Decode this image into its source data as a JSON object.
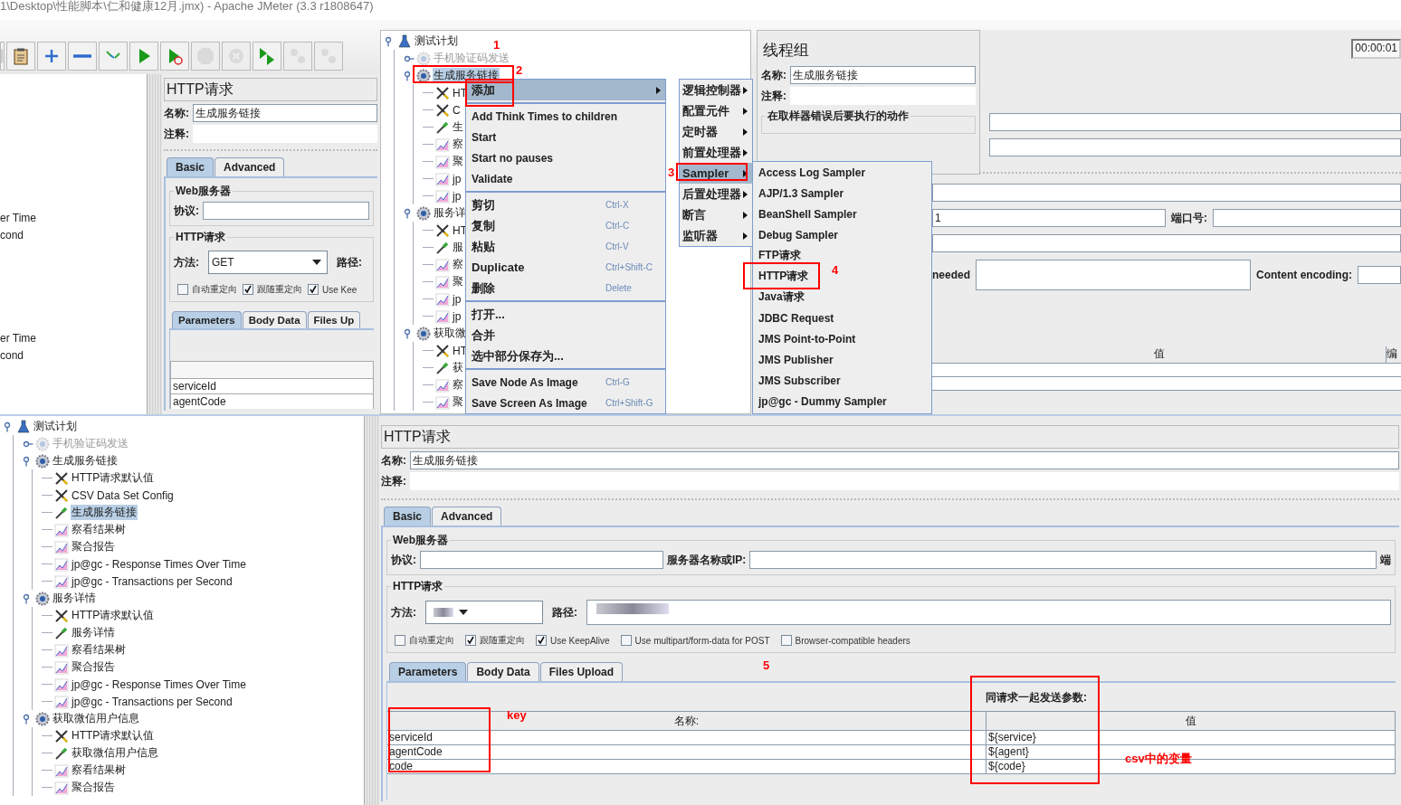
{
  "top": {
    "window": {
      "title": "1\\Desktop\\性能脚本\\仁和健康12月.jmx) - Apache JMeter (3.3 r1808647)"
    },
    "toolbar": [
      {
        "kind": "edge",
        "disabled": false
      },
      {
        "kind": "paste",
        "disabled": false
      },
      {
        "kind": "expand",
        "disabled": false
      },
      {
        "kind": "collapse",
        "disabled": false
      },
      {
        "kind": "toggle",
        "disabled": false
      },
      {
        "kind": "start",
        "disabled": false
      },
      {
        "kind": "start_no_pause",
        "disabled": false
      },
      {
        "kind": "stop",
        "disabled": true
      },
      {
        "kind": "shutdown",
        "disabled": true
      },
      {
        "kind": "remote_start",
        "disabled": false
      },
      {
        "kind": "remote_stop",
        "disabled": true
      },
      {
        "kind": "remote_shutdown",
        "disabled": true
      }
    ],
    "tree_fragments": [
      "er Time",
      "cond",
      "er Time",
      "cond"
    ],
    "http_panel": {
      "title": "HTTP请求",
      "name_label": "名称:",
      "name_value": "生成服务链接",
      "comment_label": "注释:",
      "tabs": [
        {
          "label": "Basic",
          "selected": true
        },
        {
          "label": "Advanced",
          "selected": false
        }
      ],
      "web_group": "Web服务器",
      "protocol_label": "协议:",
      "http_group": "HTTP请求",
      "method_label": "方法:",
      "method_value": "GET",
      "path_label": "路径:",
      "checkboxes": [
        {
          "label": "自动重定向",
          "checked": false
        },
        {
          "label": "跟随重定向",
          "checked": true
        },
        {
          "label": "Use Kee",
          "checked": true
        }
      ],
      "param_tabs": [
        {
          "label": "Parameters",
          "selected": true
        },
        {
          "label": "Body Data",
          "selected": false
        },
        {
          "label": "Files Up",
          "selected": false
        }
      ],
      "rows": [
        "serviceId",
        "agentCode"
      ]
    },
    "tree": [
      {
        "kind": "plan",
        "label": "测试计划",
        "selected": false,
        "disabled": false,
        "expanded": true,
        "children": [
          {
            "kind": "thread_group",
            "label": "手机验证码发送",
            "selected": false,
            "disabled": true,
            "expanded": false
          },
          {
            "kind": "thread_group",
            "label": "生成服务链接",
            "selected": true,
            "disabled": false,
            "expanded": true,
            "children": [
              {
                "kind": "config",
                "label": "HT",
                "selected": false,
                "disabled": false
              },
              {
                "kind": "config",
                "label": "C",
                "selected": false,
                "disabled": false
              },
              {
                "kind": "sampler",
                "label": "生",
                "selected": false,
                "disabled": false
              },
              {
                "kind": "listener",
                "label": "察",
                "selected": false,
                "disabled": false
              },
              {
                "kind": "listener",
                "label": "聚",
                "selected": false,
                "disabled": false
              },
              {
                "kind": "listener",
                "label": "jp",
                "selected": false,
                "disabled": false
              },
              {
                "kind": "listener",
                "label": "jp",
                "selected": false,
                "disabled": false
              }
            ]
          },
          {
            "kind": "thread_group",
            "label": "服务详",
            "selected": false,
            "disabled": false,
            "expanded": true,
            "children": [
              {
                "kind": "config",
                "label": "HT",
                "selected": false,
                "disabled": false
              },
              {
                "kind": "sampler",
                "label": "服",
                "selected": false,
                "disabled": false
              },
              {
                "kind": "listener",
                "label": "察",
                "selected": false,
                "disabled": false
              },
              {
                "kind": "listener",
                "label": "聚",
                "selected": false,
                "disabled": false
              },
              {
                "kind": "listener",
                "label": "jp",
                "selected": false,
                "disabled": false
              },
              {
                "kind": "listener",
                "label": "jp",
                "selected": false,
                "disabled": false
              }
            ]
          },
          {
            "kind": "thread_group",
            "label": "获取微",
            "selected": false,
            "disabled": false,
            "expanded": true,
            "children": [
              {
                "kind": "config",
                "label": "HT",
                "selected": false,
                "disabled": false
              },
              {
                "kind": "sampler",
                "label": "获",
                "selected": false,
                "disabled": false
              },
              {
                "kind": "listener",
                "label": "察",
                "selected": false,
                "disabled": false
              },
              {
                "kind": "listener",
                "label": "聚",
                "selected": false,
                "disabled": false
              }
            ]
          }
        ]
      }
    ],
    "context_menu": [
      [
        {
          "kind": "submenu",
          "label": "添加",
          "selected": true
        }
      ],
      [
        {
          "kind": "item",
          "label": "Add Think Times to children",
          "selected": false
        },
        {
          "kind": "item",
          "label": "Start",
          "selected": false
        },
        {
          "kind": "item",
          "label": "Start no pauses",
          "selected": false
        },
        {
          "kind": "item",
          "label": "Validate",
          "selected": false
        }
      ],
      [
        {
          "kind": "item",
          "label": "剪切",
          "shortcut": "Ctrl-X",
          "selected": false
        },
        {
          "kind": "item",
          "label": "复制",
          "shortcut": "Ctrl-C",
          "selected": false
        },
        {
          "kind": "item",
          "label": "粘贴",
          "shortcut": "Ctrl-V",
          "selected": false
        },
        {
          "kind": "item",
          "label": "Duplicate",
          "shortcut": "Ctrl+Shift-C",
          "selected": false
        },
        {
          "kind": "item",
          "label": "删除",
          "shortcut": "Delete",
          "selected": false
        }
      ],
      [
        {
          "kind": "item",
          "label": "打开...",
          "selected": false
        },
        {
          "kind": "item",
          "label": "合并",
          "selected": false
        },
        {
          "kind": "item",
          "label": "选中部分保存为...",
          "selected": false
        }
      ],
      [
        {
          "kind": "item",
          "label": "Save Node As Image",
          "shortcut": "Ctrl-G",
          "selected": false
        },
        {
          "kind": "item",
          "label": "Save Screen As Image",
          "shortcut": "Ctrl+Shift-G",
          "selected": false
        }
      ]
    ],
    "add_submenu": [
      {
        "label": "逻辑控制器",
        "selected": false
      },
      {
        "label": "配置元件",
        "selected": false
      },
      {
        "label": "定时器",
        "selected": false
      },
      {
        "label": "前置处理器",
        "selected": false
      },
      {
        "label": "Sampler",
        "selected": true
      },
      {
        "label": "后置处理器",
        "selected": false
      },
      {
        "label": "断言",
        "selected": false
      },
      {
        "label": "监听器",
        "selected": false
      }
    ],
    "sampler_submenu": [
      {
        "label": "Access Log Sampler",
        "selected": false
      },
      {
        "label": "AJP/1.3 Sampler",
        "selected": false
      },
      {
        "label": "BeanShell Sampler",
        "selected": false
      },
      {
        "label": "Debug Sampler",
        "selected": false
      },
      {
        "label": "FTP请求",
        "selected": false
      },
      {
        "label": "HTTP请求",
        "selected": false
      },
      {
        "label": "Java请求",
        "selected": false
      },
      {
        "label": "JDBC Request",
        "selected": false
      },
      {
        "label": "JMS Point-to-Point",
        "selected": false
      },
      {
        "label": "JMS Publisher",
        "selected": false
      },
      {
        "label": "JMS Subscriber",
        "selected": false
      },
      {
        "label": "jp@gc - Dummy Sampler",
        "selected": false
      }
    ],
    "thread_group_panel": {
      "title": "线程组",
      "name_label": "名称:",
      "name_value": "生成服务链接",
      "comment_label": "注释:",
      "error_group": "在取样器错误后要执行的动作"
    },
    "background": {
      "timer": "00:00:01",
      "field_fragment": "1",
      "port_label": "端口号:",
      "fragment": "needed",
      "encoding_label": "Content encoding:",
      "value_header": "值",
      "cut_header": "编"
    },
    "annotations": [
      "1",
      "2",
      "3",
      "4"
    ]
  },
  "bottom": {
    "tree": [
      {
        "kind": "plan",
        "label": "测试计划",
        "selected": false,
        "disabled": false,
        "expanded": true,
        "children": [
          {
            "kind": "thread_group",
            "label": "手机验证码发送",
            "selected": false,
            "disabled": true,
            "expanded": false
          },
          {
            "kind": "thread_group",
            "label": "生成服务链接",
            "selected": false,
            "disabled": false,
            "expanded": true,
            "children": [
              {
                "kind": "config",
                "label": "HTTP请求默认值",
                "selected": false,
                "disabled": false
              },
              {
                "kind": "config",
                "label": "CSV Data Set Config",
                "selected": false,
                "disabled": false
              },
              {
                "kind": "sampler",
                "label": "生成服务链接",
                "selected": true,
                "disabled": false
              },
              {
                "kind": "listener",
                "label": "察看结果树",
                "selected": false,
                "disabled": false
              },
              {
                "kind": "listener",
                "label": "聚合报告",
                "selected": false,
                "disabled": false
              },
              {
                "kind": "listener",
                "label": "jp@gc - Response Times Over Time",
                "selected": false,
                "disabled": false
              },
              {
                "kind": "listener",
                "label": "jp@gc - Transactions per Second",
                "selected": false,
                "disabled": false
              }
            ]
          },
          {
            "kind": "thread_group",
            "label": "服务详情",
            "selected": false,
            "disabled": false,
            "expanded": true,
            "children": [
              {
                "kind": "config",
                "label": "HTTP请求默认值",
                "selected": false,
                "disabled": false
              },
              {
                "kind": "sampler",
                "label": "服务详情",
                "selected": false,
                "disabled": false
              },
              {
                "kind": "listener",
                "label": "察看结果树",
                "selected": false,
                "disabled": false
              },
              {
                "kind": "listener",
                "label": "聚合报告",
                "selected": false,
                "disabled": false
              },
              {
                "kind": "listener",
                "label": "jp@gc - Response Times Over Time",
                "selected": false,
                "disabled": false
              },
              {
                "kind": "listener",
                "label": "jp@gc - Transactions per Second",
                "selected": false,
                "disabled": false
              }
            ]
          },
          {
            "kind": "thread_group",
            "label": "获取微信用户信息",
            "selected": false,
            "disabled": false,
            "expanded": true,
            "children": [
              {
                "kind": "config",
                "label": "HTTP请求默认值",
                "selected": false,
                "disabled": false
              },
              {
                "kind": "sampler",
                "label": "获取微信用户信息",
                "selected": false,
                "disabled": false
              },
              {
                "kind": "listener",
                "label": "察看结果树",
                "selected": false,
                "disabled": false
              },
              {
                "kind": "listener",
                "label": "聚合报告",
                "selected": false,
                "disabled": false
              }
            ]
          }
        ]
      }
    ],
    "http_panel": {
      "title": "HTTP请求",
      "name_label": "名称:",
      "name_value": "生成服务链接",
      "comment_label": "注释:",
      "tabs": [
        {
          "label": "Basic",
          "selected": true
        },
        {
          "label": "Advanced",
          "selected": false
        }
      ],
      "web_group": "Web服务器",
      "protocol_label": "协议:",
      "server_label": "服务器名称或IP:",
      "port_label_cut": "端",
      "http_group": "HTTP请求",
      "method_label": "方法:",
      "path_label": "路径:",
      "checkboxes": [
        {
          "label": "自动重定向",
          "checked": false
        },
        {
          "label": "跟随重定向",
          "checked": true
        },
        {
          "label": "Use KeepAlive",
          "checked": true
        },
        {
          "label": "Use multipart/form-data for POST",
          "checked": false
        },
        {
          "label": "Browser-compatible headers",
          "checked": false
        }
      ],
      "param_tabs": [
        {
          "label": "Parameters",
          "selected": true
        },
        {
          "label": "Body Data",
          "selected": false
        },
        {
          "label": "Files Upload",
          "selected": false
        }
      ],
      "table_caption": "同请求一起发送参数:",
      "columns": [
        "名称:",
        "值"
      ],
      "rows": [
        [
          "serviceId",
          "${service}"
        ],
        [
          "agentCode",
          "${agent}"
        ],
        [
          "code",
          "${code}"
        ]
      ]
    },
    "annotations": [
      "5",
      "key",
      "csv中的变量"
    ]
  }
}
